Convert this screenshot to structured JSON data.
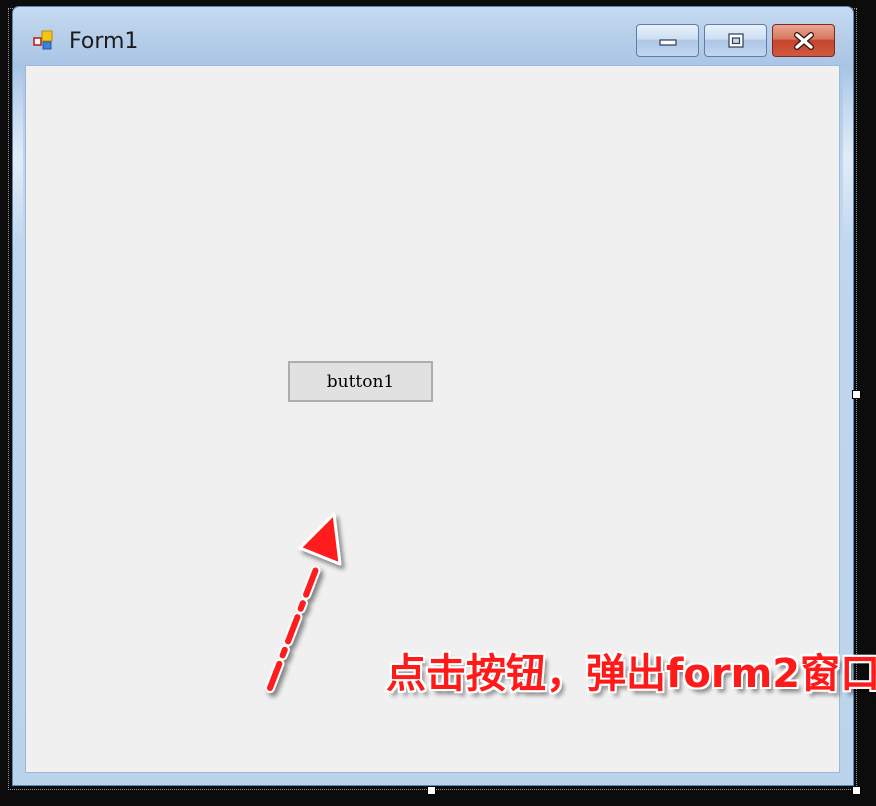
{
  "window": {
    "title": "Form1",
    "controls": {
      "minimize": "minimize-icon",
      "maximize": "maximize-icon",
      "close": "close-icon"
    }
  },
  "form": {
    "button1_label": "button1"
  },
  "annotation": {
    "text": "点击按钮，弹出form2窗口",
    "color": "#ff1a1a"
  },
  "colors": {
    "accent": "#ff0000",
    "client_bg": "#f0f0f0"
  }
}
